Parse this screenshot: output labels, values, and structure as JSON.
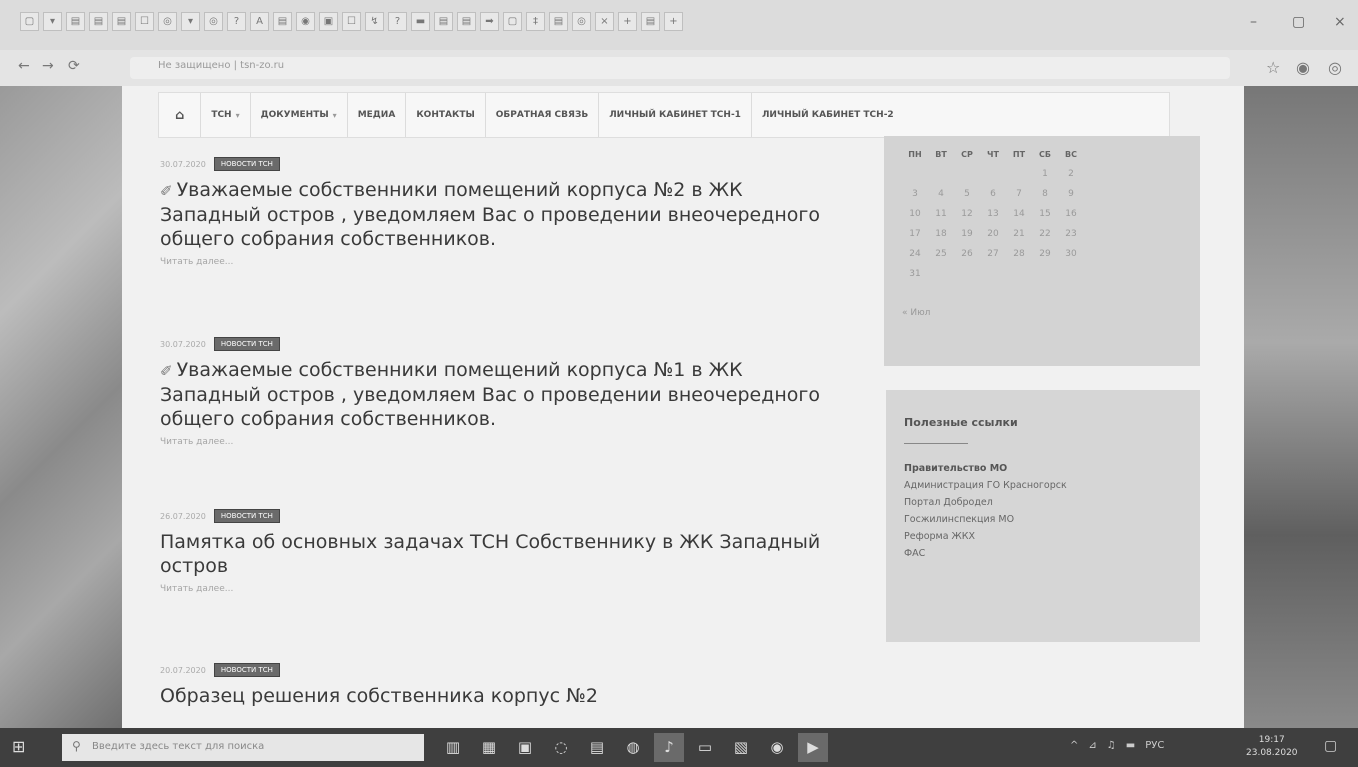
{
  "browser": {
    "tab_icons": [
      "▢",
      "▾",
      "▤",
      "▤",
      "▤",
      "☐",
      "◎",
      "▾",
      "◎",
      "?",
      "A",
      "▤",
      "◉",
      "▣",
      "☐",
      "↯",
      "?",
      "▬",
      "▤",
      "▤",
      "➡",
      "▢",
      "‡",
      "▤",
      "◎",
      "×",
      "+",
      "▤",
      "+"
    ],
    "window_controls": {
      "minimize": "–",
      "maximize": "▢",
      "close": "×"
    },
    "nav": {
      "back": "←",
      "forward": "→",
      "reload": "⟳"
    },
    "address": "Не защищено | tsn-zo.ru",
    "address_icons": {
      "star": "☆",
      "account": "◉",
      "menu": "◎"
    }
  },
  "site_nav": {
    "home_icon": "⌂",
    "items": [
      {
        "label": "ТСН",
        "dropdown": true
      },
      {
        "label": "ДОКУМЕНТЫ",
        "dropdown": true
      },
      {
        "label": "МЕДИА",
        "dropdown": false
      },
      {
        "label": "КОНТАКТЫ",
        "dropdown": false
      },
      {
        "label": "ОБРАТНАЯ СВЯЗЬ",
        "dropdown": false
      },
      {
        "label": "ЛИЧНЫЙ КАБИНЕТ ТСН-1",
        "dropdown": false
      },
      {
        "label": "ЛИЧНЫЙ КАБИНЕТ ТСН-2",
        "dropdown": false
      }
    ]
  },
  "posts": [
    {
      "date": "30.07.2020",
      "badge": "НОВОСТИ ТСН",
      "pin": "✐",
      "title": "Уважаемые собственники помещений корпуса №2 в ЖК Западный остров , уведомляем Вас о проведении внеочередного общего собрания собственников.",
      "more": "Читать далее..."
    },
    {
      "date": "30.07.2020",
      "badge": "НОВОСТИ ТСН",
      "pin": "✐",
      "title": "Уважаемые собственники помещений корпуса №1 в ЖК Западный остров , уведомляем Вас о проведении внеочередного общего собрания собственников.",
      "more": "Читать далее..."
    },
    {
      "date": "26.07.2020",
      "badge": "НОВОСТИ ТСН",
      "pin": "",
      "title": "Памятка об основных задачах ТСН Собственнику в ЖК Западный остров",
      "more": "Читать далее..."
    },
    {
      "date": "20.07.2020",
      "badge": "НОВОСТИ ТСН",
      "pin": "",
      "title": "Образец решения собственника корпус №2",
      "more": ""
    }
  ],
  "calendar": {
    "weekdays": [
      "ПН",
      "ВТ",
      "СР",
      "ЧТ",
      "ПТ",
      "СБ",
      "ВС"
    ],
    "weeks": [
      [
        "",
        "",
        "",
        "",
        "",
        "1",
        "2"
      ],
      [
        "3",
        "4",
        "5",
        "6",
        "7",
        "8",
        "9"
      ],
      [
        "10",
        "11",
        "12",
        "13",
        "14",
        "15",
        "16"
      ],
      [
        "17",
        "18",
        "19",
        "20",
        "21",
        "22",
        "23"
      ],
      [
        "24",
        "25",
        "26",
        "27",
        "28",
        "29",
        "30"
      ],
      [
        "31",
        "",
        "",
        "",
        "",
        "",
        ""
      ]
    ],
    "prev": "« Июл"
  },
  "links": {
    "title": "Полезные ссылки",
    "items": [
      "Правительство МО",
      "Администрация ГО Красногорск",
      "Портал Добродел",
      "Госжилинспекция МО",
      "Реформа ЖКХ",
      "ФАС"
    ]
  },
  "taskbar": {
    "start_icon": "⊞",
    "search_icon": "⚲",
    "search_placeholder": "Введите здесь текст для поиска",
    "apps": [
      "▥",
      "▦",
      "▣",
      "◌",
      "▤",
      "◍",
      "♪",
      "▭",
      "▧",
      "◉",
      "▶"
    ],
    "tray": [
      "^",
      "⊿",
      "♫",
      "▬",
      "РУС"
    ],
    "time": "19:17",
    "date": "23.08.2020",
    "notif_icon": "▢"
  }
}
